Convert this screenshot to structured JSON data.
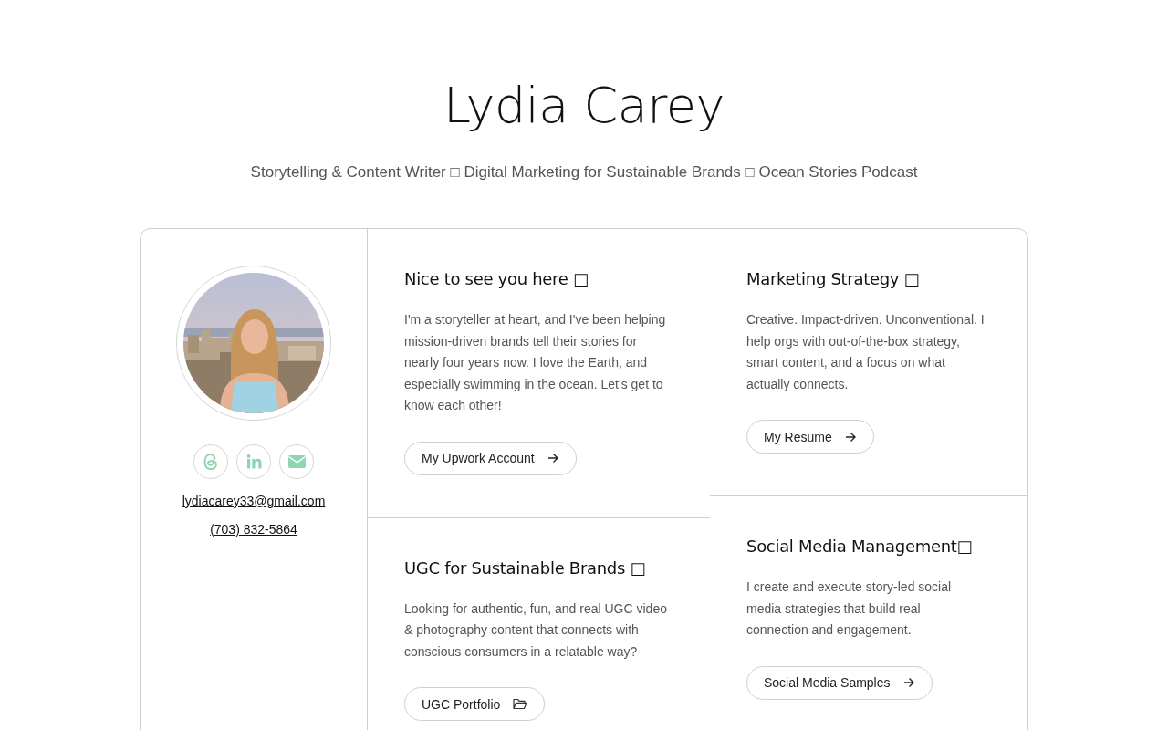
{
  "header": {
    "name": "Lydia Carey",
    "tagline": "Storytelling & Content Writer □ Digital Marketing for Sustainable Brands □ Ocean Stories Podcast"
  },
  "profile": {
    "social_links": [
      {
        "kind": "threads"
      },
      {
        "kind": "linkedin"
      },
      {
        "kind": "email"
      }
    ],
    "email": "lydiacarey33@gmail.com",
    "phone": "(703) 832-5864"
  },
  "columns": [
    {
      "cards": [
        {
          "title": "Nice to see you here □",
          "body": "I'm a storyteller at heart, and I've been helping mission-driven brands tell their stories for nearly four years now. I love the Earth, and especially swimming in the ocean. Let's get to know each other!",
          "button": {
            "label": "My Upwork Account",
            "kind": "arrow"
          }
        },
        {
          "title": "UGC for Sustainable Brands □",
          "body": "Looking for authentic, fun, and real UGC video & photography content that connects with conscious consumers in a relatable way?",
          "button": {
            "label": "UGC Portfolio",
            "kind": "folder"
          }
        }
      ]
    },
    {
      "cards": [
        {
          "title": "Marketing Strategy □",
          "body": "Creative. Impact-driven. Unconventional. I help orgs with out-of-the-box strategy, smart content, and a focus on what actually connects.",
          "button": {
            "label": "My Resume",
            "kind": "arrow"
          }
        },
        {
          "title": "Social Media Management□",
          "body": "I create and execute story-led social media strategies that build real connection and engagement.",
          "button": {
            "label": "Social Media Samples",
            "kind": "arrow"
          }
        }
      ]
    }
  ]
}
